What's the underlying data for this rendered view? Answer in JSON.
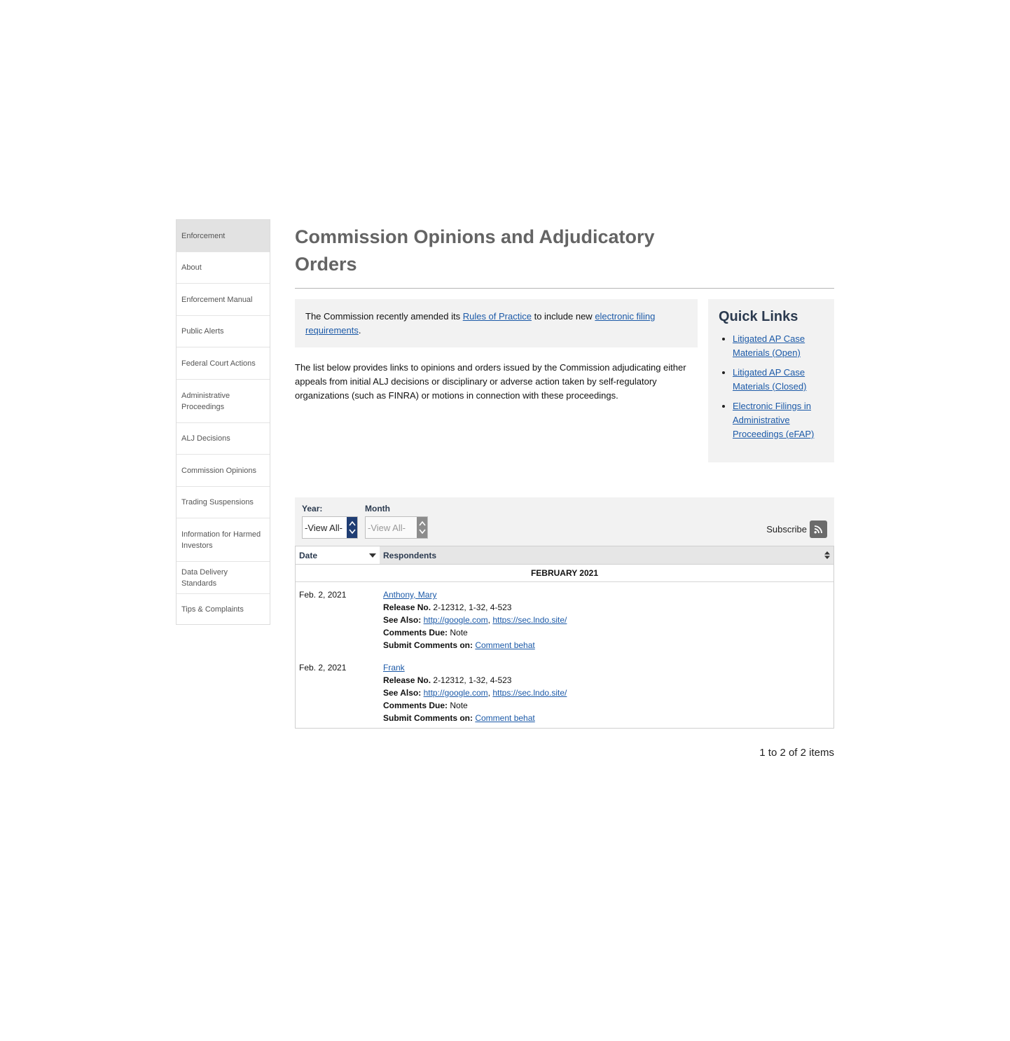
{
  "sidebar": {
    "items": [
      {
        "label": "Enforcement"
      },
      {
        "label": "About"
      },
      {
        "label": "Enforcement Manual"
      },
      {
        "label": "Public Alerts"
      },
      {
        "label": "Federal Court Actions"
      },
      {
        "label": "Administrative Proceedings"
      },
      {
        "label": "ALJ Decisions"
      },
      {
        "label": "Commission Opinions"
      },
      {
        "label": "Trading Suspensions"
      },
      {
        "label": "Information for Harmed Investors"
      },
      {
        "label": "Data Delivery Standards"
      },
      {
        "label": "Tips & Complaints"
      }
    ]
  },
  "page": {
    "title": "Commission Opinions and Adjudicatory Orders"
  },
  "notice": {
    "text_before": "The Commission recently amended its ",
    "link1": "Rules of Practice",
    "text_middle": " to include new ",
    "link2": "electronic filing requirements",
    "text_after": "."
  },
  "intro": "The list below provides links to opinions and orders issued by the Commission adjudicating either appeals from initial ALJ decisions or disciplinary or adverse action taken by self-regulatory organizations (such as FINRA) or motions in connection with these proceedings.",
  "quick_links": {
    "title": "Quick Links",
    "items": [
      {
        "label": "Litigated AP Case Materials (Open)"
      },
      {
        "label": "Litigated AP Case Materials (Closed)"
      },
      {
        "label": "Electronic Filings in Administrative Proceedings (eFAP)"
      }
    ]
  },
  "filters": {
    "year_label": "Year:",
    "year_value": "-View All-",
    "month_label": "Month",
    "month_value": "-View All-",
    "subscribe_label": "Subscribe"
  },
  "table": {
    "col_date": "Date",
    "col_respondents": "Respondents",
    "group": "FEBRUARY 2021",
    "labels": {
      "release": "Release No.",
      "see_also": "See Also:",
      "comments_due": "Comments Due:",
      "submit": "Submit Comments on:"
    },
    "rows": [
      {
        "date": "Feb. 2, 2021",
        "respondent": "Anthony, Mary",
        "release_no": "2-12312, 1-32, 4-523",
        "see_also_1": "http://google.com",
        "see_also_2": "https://sec.lndo.site/",
        "comments_due": "Note",
        "submit_link": "Comment behat"
      },
      {
        "date": "Feb. 2, 2021",
        "respondent": "Frank",
        "release_no": "2-12312, 1-32, 4-523",
        "see_also_1": "http://google.com",
        "see_also_2": "https://sec.lndo.site/",
        "comments_due": "Note",
        "submit_link": "Comment behat"
      }
    ]
  },
  "pager": "1 to 2 of 2 items",
  "colors": {
    "link": "#1c5aa8",
    "heading": "#646464",
    "panel": "#f2f2f2",
    "select_arrow_active": "#1f3d73",
    "select_arrow_disabled": "#8c8c8c"
  }
}
